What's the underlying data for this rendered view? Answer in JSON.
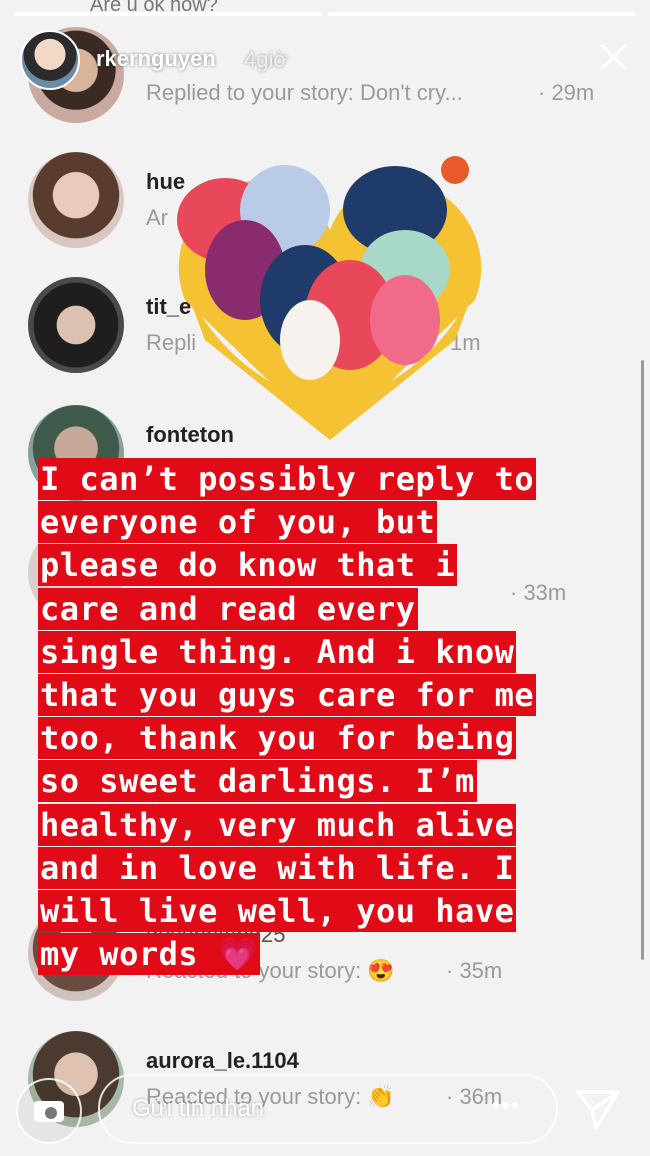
{
  "top_partial_message": "Are u ok now?",
  "story": {
    "username": "rkernguyen",
    "time_ago": "4giờ",
    "progress_segments": 2,
    "progress_complete": 1
  },
  "dm_list": [
    {
      "name": "",
      "message": "Replied to your story: Don't cry...",
      "time": "· 29m"
    },
    {
      "name": "hue",
      "message": "Ar",
      "time": ""
    },
    {
      "name": "tit_e",
      "message": "Repli",
      "time": "1m"
    },
    {
      "name": "fonteton",
      "message": "",
      "time": ""
    },
    {
      "name": "",
      "message": "",
      "time": "· 33m"
    },
    {
      "name": "duyenntang25",
      "message": "Reacted to your story: 😍",
      "time": "· 35m"
    },
    {
      "name": "aurora_le.1104",
      "message": "Reacted to your story: 👏",
      "time": "· 36m"
    }
  ],
  "caption_lines": [
    "I can’t possibly reply to",
    "everyone of you, but",
    "please do know that i",
    "care and read every",
    "single thing.  And i know",
    "that you guys care for me",
    "too, thank you for being",
    "so sweet darlings. I’m",
    "healthy, very much alive",
    "and in love with life. I",
    "will live well, you have",
    "my words 💗"
  ],
  "bottom_bar": {
    "placeholder": "Gửi tin nhắn",
    "more": "•••"
  },
  "colors": {
    "caption_bg": "#e00b16",
    "caption_text": "#ffffff"
  },
  "icons": [
    "camera-icon",
    "close-icon",
    "send-icon",
    "more-icon"
  ]
}
